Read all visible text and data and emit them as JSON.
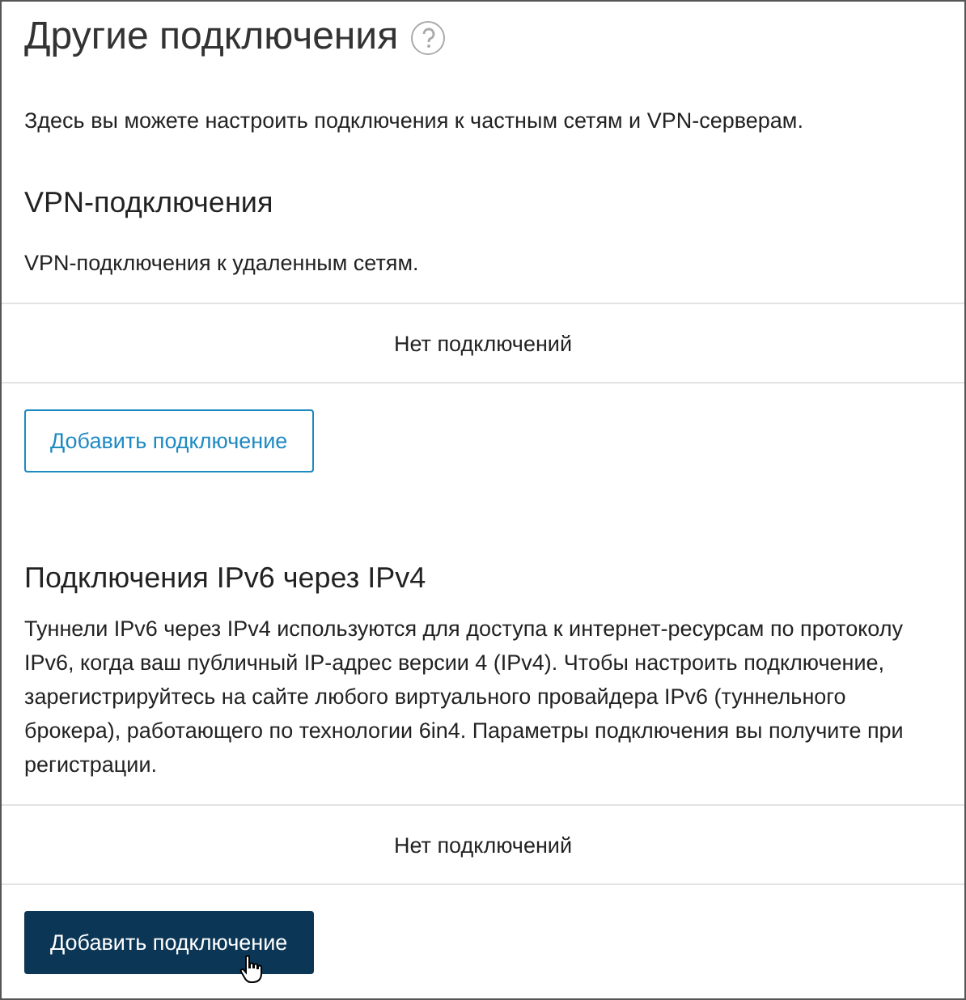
{
  "page": {
    "title": "Другие подключения",
    "description": "Здесь вы можете настроить подключения к частным сетям и VPN-серверам."
  },
  "sections": [
    {
      "heading": "VPN-подключения",
      "description": "VPN-подключения к удаленным сетям.",
      "empty_text": "Нет подключений",
      "button": {
        "label": "Добавить подключение",
        "kind": "outline",
        "hovered": false
      }
    },
    {
      "heading": "Подключения IPv6 через IPv4",
      "description": "Туннели IPv6 через IPv4 используются для доступа к интернет-ресурсам по протоколу IPv6, когда ваш публичный IP-адрес версии 4 (IPv4). Чтобы настроить подключение, зарегистрируйтесь на сайте любого виртуального провайдера IPv6 (туннельного брокера), работающего по технологии 6in4. Параметры подключения вы получите при регистрации.",
      "empty_text": "Нет подключений",
      "button": {
        "label": "Добавить подключение",
        "kind": "filled",
        "hovered": true
      }
    }
  ]
}
